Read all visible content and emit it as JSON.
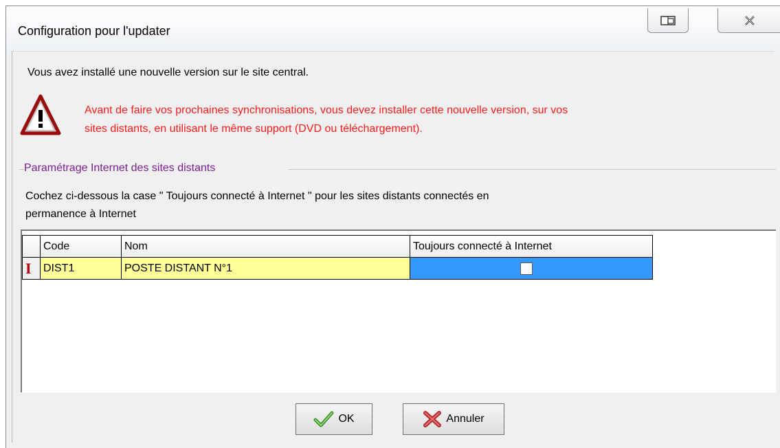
{
  "window": {
    "title": "Configuration pour l'updater"
  },
  "titlebar_buttons": {
    "restore_icon": "window-restore-icon",
    "close_icon": "close-icon",
    "close_glyph": "☒"
  },
  "message": {
    "intro": "Vous avez installé une nouvelle version sur le site central.",
    "warning_line1": "Avant de faire vos prochaines synchronisations, vous devez installer cette nouvelle version, sur vos",
    "warning_line2": "sites distants, en utilisant le même support (DVD ou téléchargement).",
    "warning_icon": "warning-triangle-icon",
    "warning_color": "#ff1a1a"
  },
  "group": {
    "title": "Paramétrage Internet des sites distants",
    "title_color": "#7a1f8f",
    "desc_line1": "Cochez ci-dessous la case \" Toujours connecté à Internet \" pour les sites distants connectés en",
    "desc_line2": "permanence à Internet"
  },
  "grid": {
    "columns": [
      "Code",
      "Nom",
      "Toujours connecté à Internet"
    ],
    "rows": [
      {
        "code": "DIST1",
        "nom": "POSTE DISTANT N°1",
        "toujours_connecte": false
      }
    ],
    "row_marker": "I",
    "selected_color": "#3399ff",
    "row_color": "#ffff99"
  },
  "buttons": {
    "ok_label": "OK",
    "ok_icon": "checkmark-icon",
    "cancel_label": "Annuler",
    "cancel_icon": "red-x-icon"
  }
}
